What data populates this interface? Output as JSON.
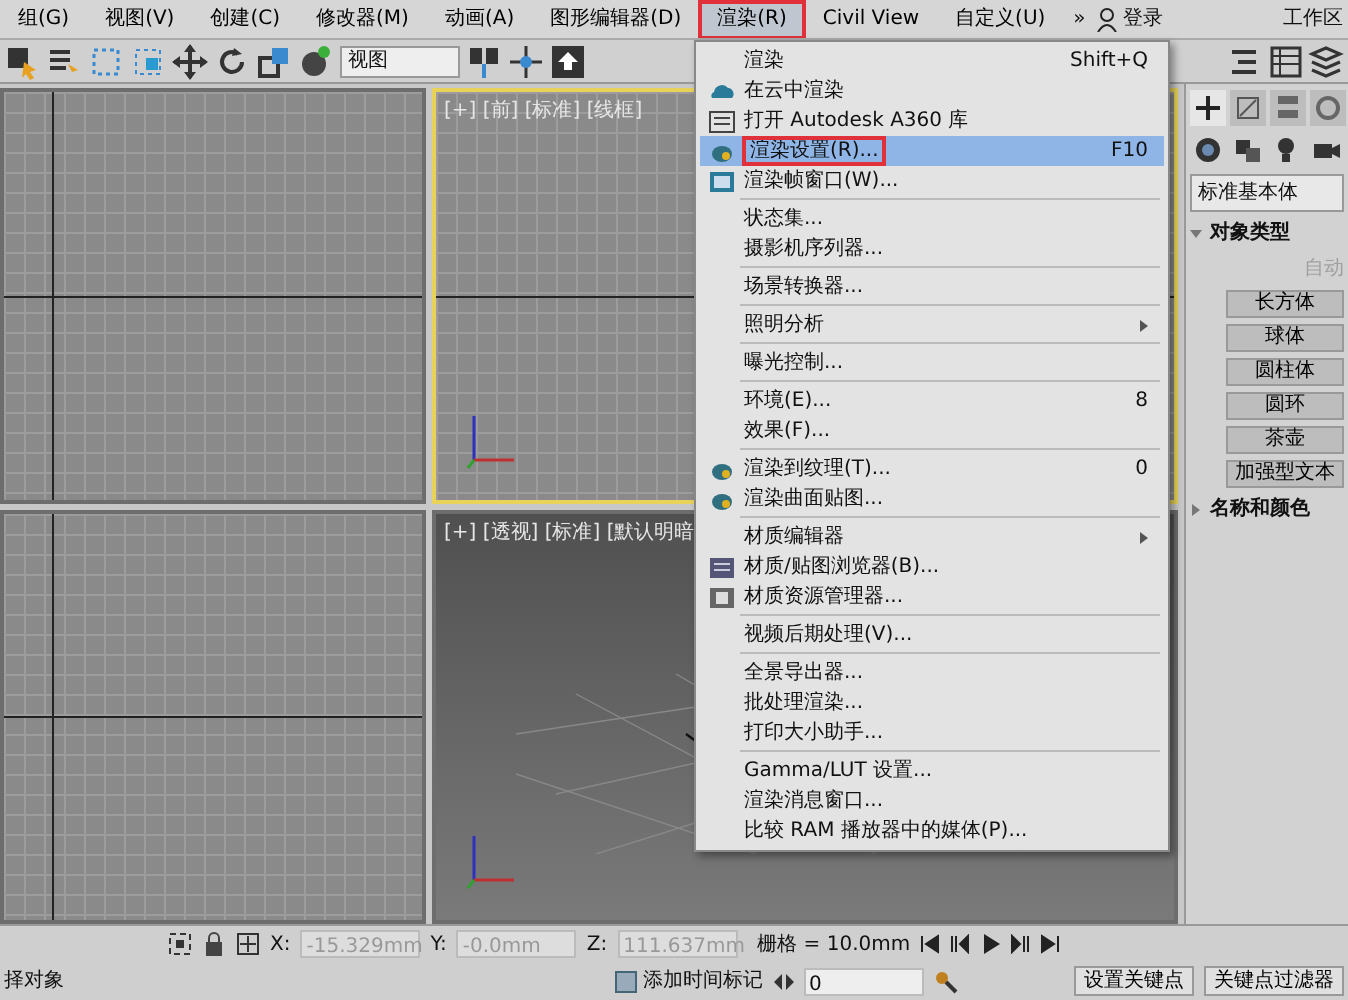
{
  "menu_bar": {
    "items": [
      {
        "label": "组(G)",
        "selected": false,
        "annotated": false
      },
      {
        "label": "视图(V)",
        "selected": false,
        "annotated": false
      },
      {
        "label": "创建(C)",
        "selected": false,
        "annotated": false
      },
      {
        "label": "修改器(M)",
        "selected": false,
        "annotated": false
      },
      {
        "label": "动画(A)",
        "selected": false,
        "annotated": false
      },
      {
        "label": "图形编辑器(D)",
        "selected": false,
        "annotated": false
      },
      {
        "label": "渲染(R)",
        "selected": true,
        "annotated": true
      },
      {
        "label": "Civil View",
        "selected": false,
        "annotated": false
      },
      {
        "label": "自定义(U)",
        "selected": false,
        "annotated": false
      }
    ],
    "overflow": "»",
    "user": "登录",
    "workspace": "工作区"
  },
  "toolbar": {
    "view_dropdown": "视图"
  },
  "viewports": [
    {
      "active": false,
      "kind": "ortho"
    },
    {
      "label": "[+] [前] [标准] [线框]",
      "active": true,
      "kind": "ortho"
    },
    {
      "active": false,
      "kind": "ortho"
    },
    {
      "label": "[+] [透视] [标准] [默认明暗",
      "active": false,
      "kind": "perspective"
    }
  ],
  "render_menu": {
    "items": [
      {
        "kind": "item",
        "label": "渲染",
        "shortcut": "Shift+Q",
        "submenu": false,
        "selected": false,
        "annotated": false
      },
      {
        "kind": "item",
        "label": "在云中渲染",
        "submenu": false,
        "selected": false,
        "annotated": false
      },
      {
        "kind": "item",
        "label": "打开 Autodesk A360 库",
        "submenu": false,
        "selected": false,
        "annotated": false
      },
      {
        "kind": "item",
        "label": "渲染设置(R)...",
        "shortcut": "F10",
        "submenu": false,
        "selected": true,
        "annotated": true
      },
      {
        "kind": "item",
        "label": "渲染帧窗口(W)...",
        "submenu": false,
        "selected": false,
        "annotated": false
      },
      {
        "kind": "separator"
      },
      {
        "kind": "item",
        "label": "状态集...",
        "submenu": false,
        "selected": false,
        "annotated": false
      },
      {
        "kind": "item",
        "label": "摄影机序列器...",
        "submenu": false,
        "selected": false,
        "annotated": false
      },
      {
        "kind": "separator"
      },
      {
        "kind": "item",
        "label": "场景转换器...",
        "submenu": false,
        "selected": false,
        "annotated": false
      },
      {
        "kind": "separator"
      },
      {
        "kind": "item",
        "label": "照明分析",
        "submenu": true,
        "selected": false,
        "annotated": false
      },
      {
        "kind": "separator"
      },
      {
        "kind": "item",
        "label": "曝光控制...",
        "submenu": false,
        "selected": false,
        "annotated": false
      },
      {
        "kind": "separator"
      },
      {
        "kind": "item",
        "label": "环境(E)...",
        "shortcut": "8",
        "submenu": false,
        "selected": false,
        "annotated": false
      },
      {
        "kind": "item",
        "label": "效果(F)...",
        "submenu": false,
        "selected": false,
        "annotated": false
      },
      {
        "kind": "separator"
      },
      {
        "kind": "item",
        "label": "渲染到纹理(T)...",
        "shortcut": "0",
        "submenu": false,
        "selected": false,
        "annotated": false
      },
      {
        "kind": "item",
        "label": "渲染曲面贴图...",
        "submenu": false,
        "selected": false,
        "annotated": false
      },
      {
        "kind": "separator"
      },
      {
        "kind": "item",
        "label": "材质编辑器",
        "submenu": true,
        "selected": false,
        "annotated": false
      },
      {
        "kind": "item",
        "label": "材质/贴图浏览器(B)...",
        "submenu": false,
        "selected": false,
        "annotated": false
      },
      {
        "kind": "item",
        "label": "材质资源管理器...",
        "submenu": false,
        "selected": false,
        "annotated": false
      },
      {
        "kind": "separator"
      },
      {
        "kind": "item",
        "label": "视频后期处理(V)...",
        "submenu": false,
        "selected": false,
        "annotated": false
      },
      {
        "kind": "separator"
      },
      {
        "kind": "item",
        "label": "全景导出器...",
        "submenu": false,
        "selected": false,
        "annotated": false
      },
      {
        "kind": "item",
        "label": "批处理渲染...",
        "submenu": false,
        "selected": false,
        "annotated": false
      },
      {
        "kind": "item",
        "label": "打印大小助手...",
        "submenu": false,
        "selected": false,
        "annotated": false
      },
      {
        "kind": "separator"
      },
      {
        "kind": "item",
        "label": "Gamma/LUT 设置...",
        "submenu": false,
        "selected": false,
        "annotated": false
      },
      {
        "kind": "item",
        "label": "渲染消息窗口...",
        "submenu": false,
        "selected": false,
        "annotated": false
      },
      {
        "kind": "item",
        "label": "比较 RAM 播放器中的媒体(P)...",
        "submenu": false,
        "selected": false,
        "annotated": false
      }
    ]
  },
  "command_panel": {
    "category_dropdown": "标准基本体",
    "rollouts": [
      {
        "title": "对象类型",
        "expanded": true,
        "auto_grid": "自动",
        "auto_grid_disabled": true,
        "buttons": [
          "长方体",
          "球体",
          "圆柱体",
          "圆环",
          "茶壶",
          "加强型文本"
        ]
      },
      {
        "title": "名称和颜色",
        "expanded": false
      }
    ]
  },
  "status_bar": {
    "prompt": "择对象",
    "x_label": "X:",
    "x_value": "-15.329mm",
    "y_label": "Y:",
    "y_value": "-0.0mm",
    "z_label": "Z:",
    "z_value": "111.637mm",
    "grid": "栅格 = 10.0mm",
    "add_time_tag": "添加时间标记",
    "frame_value": "0",
    "set_key": "设置关键点",
    "key_filters": "关键点过滤器"
  }
}
